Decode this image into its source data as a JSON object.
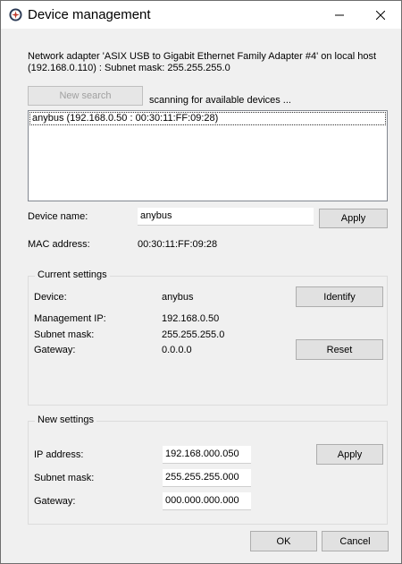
{
  "window": {
    "title": "Device management"
  },
  "adapter_info": {
    "line1": "Network adapter 'ASIX USB to Gigabit Ethernet Family Adapter #4' on local host",
    "line2": "(192.168.0.110) : Subnet mask: 255.255.255.0"
  },
  "search": {
    "button_label": "New search",
    "status": "scanning for available devices ..."
  },
  "devices": [
    "anybus (192.168.0.50 : 00:30:11:FF:09:28)"
  ],
  "device_name": {
    "label": "Device name:",
    "value": "anybus",
    "apply_label": "Apply"
  },
  "mac": {
    "label": "MAC address:",
    "value": "00:30:11:FF:09:28"
  },
  "current_settings": {
    "title": "Current settings",
    "device_label": "Device:",
    "device_value": "anybus",
    "ip_label": "Management IP:",
    "ip_value": "192.168.0.50",
    "subnet_label": "Subnet mask:",
    "subnet_value": "255.255.255.0",
    "gateway_label": "Gateway:",
    "gateway_value": "0.0.0.0",
    "identify_label": "Identify",
    "reset_label": "Reset"
  },
  "new_settings": {
    "title": "New settings",
    "ip_label": "IP address:",
    "ip_value": "192.168.000.050",
    "subnet_label": "Subnet mask:",
    "subnet_value": "255.255.255.000",
    "gateway_label": "Gateway:",
    "gateway_value": "000.000.000.000",
    "apply_label": "Apply"
  },
  "footer": {
    "ok_label": "OK",
    "cancel_label": "Cancel"
  },
  "colors": {
    "title_bar": "#ffffff",
    "dialog_bg": "#f0f0f0",
    "button_bg": "#e1e1e1",
    "app_icon": "#c0392b"
  }
}
